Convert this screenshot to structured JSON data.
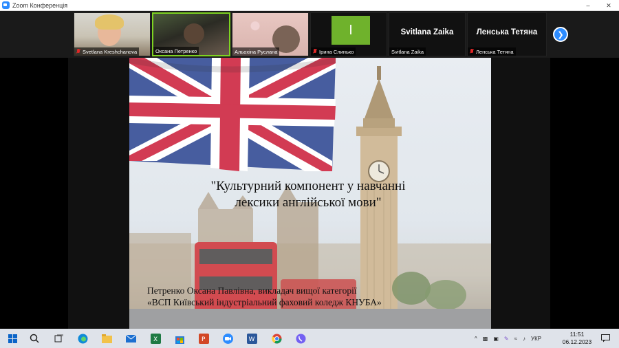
{
  "window": {
    "title": "Zoom Конференція",
    "minimize_label": "–",
    "close_label": "✕"
  },
  "gallery": {
    "participants": [
      {
        "name": "Svetlana Kreshchanova",
        "muted": true
      },
      {
        "name": "Оксана Петренко",
        "muted": false
      },
      {
        "name": "Альохіна Руслана",
        "muted": false
      },
      {
        "name": "Ірина Слинько",
        "muted": true,
        "initial": "I"
      },
      {
        "name": "Svitlana Zaika",
        "muted": false,
        "display": "Svitlana Zaika"
      },
      {
        "name": "Ленська Тетяна",
        "muted": true,
        "display": "Ленська Тетяна"
      }
    ],
    "next_label": "❯"
  },
  "slide": {
    "title_line1": "\"Культурний  компонент у навчанні",
    "title_line2": "лексики англійської мови\"",
    "author_line1": "Петренко  Оксана Павлівна, викладач вищої категорії",
    "author_line2": "«ВСП Київський індустріальний фаховий коледж КНУБА»"
  },
  "taskbar": {
    "language": "УКР",
    "time": "11:51",
    "date": "06.12.2023"
  },
  "colors": {
    "zoom_blue": "#2d8cff",
    "active_speaker": "#7ed321",
    "avatar_green": "#6fb22c",
    "muted_red": "#e02828"
  }
}
